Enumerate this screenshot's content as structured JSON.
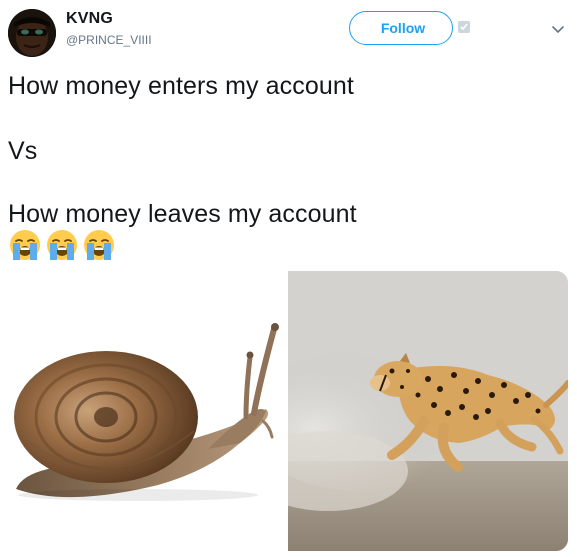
{
  "user": {
    "display_name": "KVNG",
    "handle": "@PRINCE_VIIII"
  },
  "header": {
    "follow_label": "Follow",
    "follow_icon": "verified-followed-icon",
    "menu_icon": "chevron-down-icon"
  },
  "tweet": {
    "line1": "How money enters my account",
    "line2": "Vs",
    "line3": "How money leaves my account",
    "emojis": [
      "loudly-crying-face",
      "loudly-crying-face",
      "loudly-crying-face"
    ]
  },
  "media": {
    "left_image": "snail-photo",
    "right_image": "cheetah-photo"
  },
  "colors": {
    "accent": "#1da1f2",
    "text": "#14171a",
    "secondary_text": "#657786"
  }
}
